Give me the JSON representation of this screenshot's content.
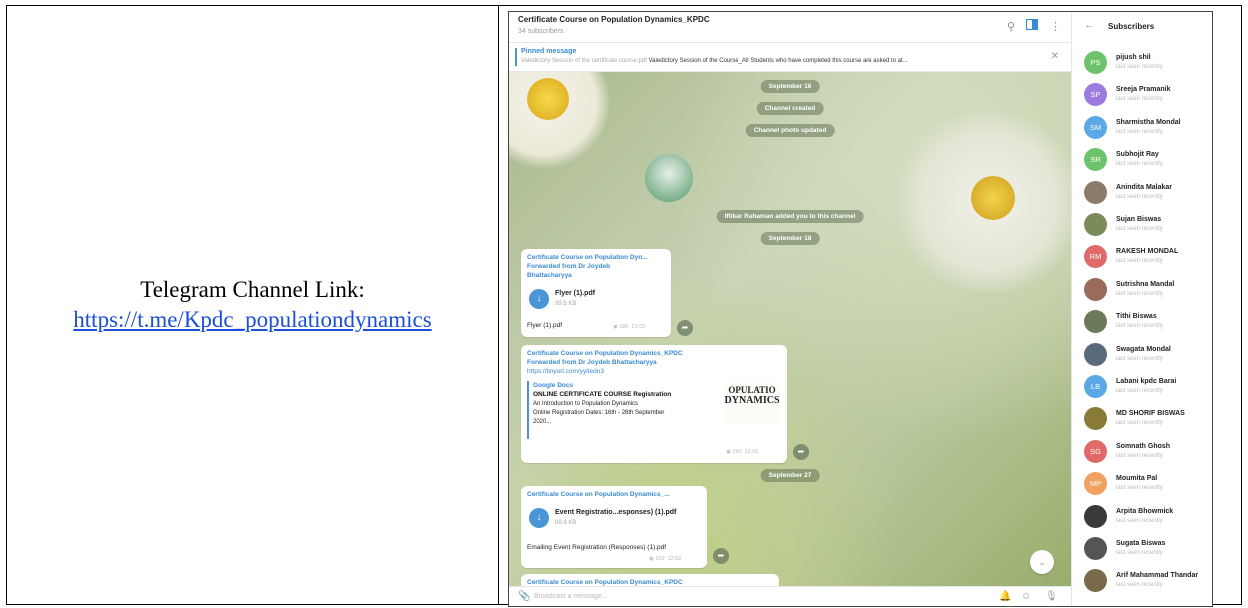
{
  "document": {
    "caption": "Telegram Channel Link:",
    "link": "https://t.me/Kpdc_populationdynamics"
  },
  "channel": {
    "title": "Certificate Course on Population Dynamics_KPDC",
    "subscribers": "34 subscribers",
    "icons": [
      "search-icon",
      "sidebar-toggle-icon",
      "more-icon"
    ]
  },
  "pinned": {
    "label": "Pinned message",
    "file": "Valedictory Session of the certificate course.pdf",
    "text": "Valedictory Session of the Course_All Students who have completed this course are asked to at..."
  },
  "service": {
    "date1": "September 16",
    "created": "Channel created",
    "photo_updated": "Channel photo updated",
    "added": "Iftikar Rahaman added you to this channel",
    "date2": "September 18",
    "date3": "September 27"
  },
  "messages": [
    {
      "title": "Certificate Course on Population Dyn...",
      "forwarded": "Forwarded from Dr Joydeb",
      "forwarded2": "Bhattacharyya",
      "file_name": "Flyer (1).pdf",
      "file_size": "99.5 KB",
      "caption": "Flyer (1).pdf",
      "views": "186",
      "time": "21:05"
    },
    {
      "title": "Certificate Course on Population Dynamics_KPDC",
      "forwarded": "Forwarded from Dr Joydeb Bhattacharyya",
      "url": "https://tinyurl.com/yyltedn3",
      "preview": {
        "site": "Google Docs",
        "title": "ONLINE CERTIFICATE COURSE Registration",
        "line1": "An Introduction to Population Dynamics",
        "line2": "Online Registration Dates: 16th - 26th September",
        "line3": "2020...",
        "thumb1": "OPULATIO",
        "thumb2": "DYNAMICS"
      },
      "views": "190",
      "time": "21:05"
    },
    {
      "title": "Certificate Course on Population Dynamics_...",
      "file_name": "Event Registratio...esponses) (1).pdf",
      "file_size": "89.4 KB",
      "caption": "Emailing Event Registration (Responses) (1).pdf",
      "views": "109",
      "time": "12:02"
    },
    {
      "title": "Certificate Course on Population Dynamics_KPDC"
    }
  ],
  "composer": {
    "placeholder": "Broadcast a message..."
  },
  "sidebar": {
    "title": "Subscribers",
    "status": "last seen recently",
    "members": [
      {
        "name": "pijush shil",
        "initials": "PS",
        "color": "#6cc36c"
      },
      {
        "name": "Sreeja Pramanik",
        "initials": "SP",
        "color": "#9b7be0"
      },
      {
        "name": "Sharmistha Mondal",
        "initials": "SM",
        "color": "#5aa9e6"
      },
      {
        "name": "Subhojit Ray",
        "initials": "SR",
        "color": "#6cc36c"
      },
      {
        "name": "Anindita Malakar",
        "initials": "",
        "color": "#8c7a6b"
      },
      {
        "name": "Sujan Biswas",
        "initials": "",
        "color": "#7a8c5a"
      },
      {
        "name": "RAKESH MONDAL",
        "initials": "RM",
        "color": "#e06a6a"
      },
      {
        "name": "Sutrishna Mandal",
        "initials": "",
        "color": "#9a6a5a"
      },
      {
        "name": "Tithi Biswas",
        "initials": "",
        "color": "#6a7a5a"
      },
      {
        "name": "Swagata Mondal",
        "initials": "",
        "color": "#5a6a7a"
      },
      {
        "name": "Labani kpdc Barai",
        "initials": "LB",
        "color": "#5aa9e6"
      },
      {
        "name": "MD SHORIF BISWAS",
        "initials": "",
        "color": "#8a7a3a"
      },
      {
        "name": "Somnath Ghosh",
        "initials": "SG",
        "color": "#e06a6a"
      },
      {
        "name": "Moumita Pal",
        "initials": "MP",
        "color": "#f0a060"
      },
      {
        "name": "Arpita Bhowmick",
        "initials": "",
        "color": "#3a3a3a"
      },
      {
        "name": "Sugata Biswas",
        "initials": "",
        "color": "#555555"
      },
      {
        "name": "Arif Mahammad Thandar",
        "initials": "",
        "color": "#7a6a4a"
      }
    ]
  }
}
